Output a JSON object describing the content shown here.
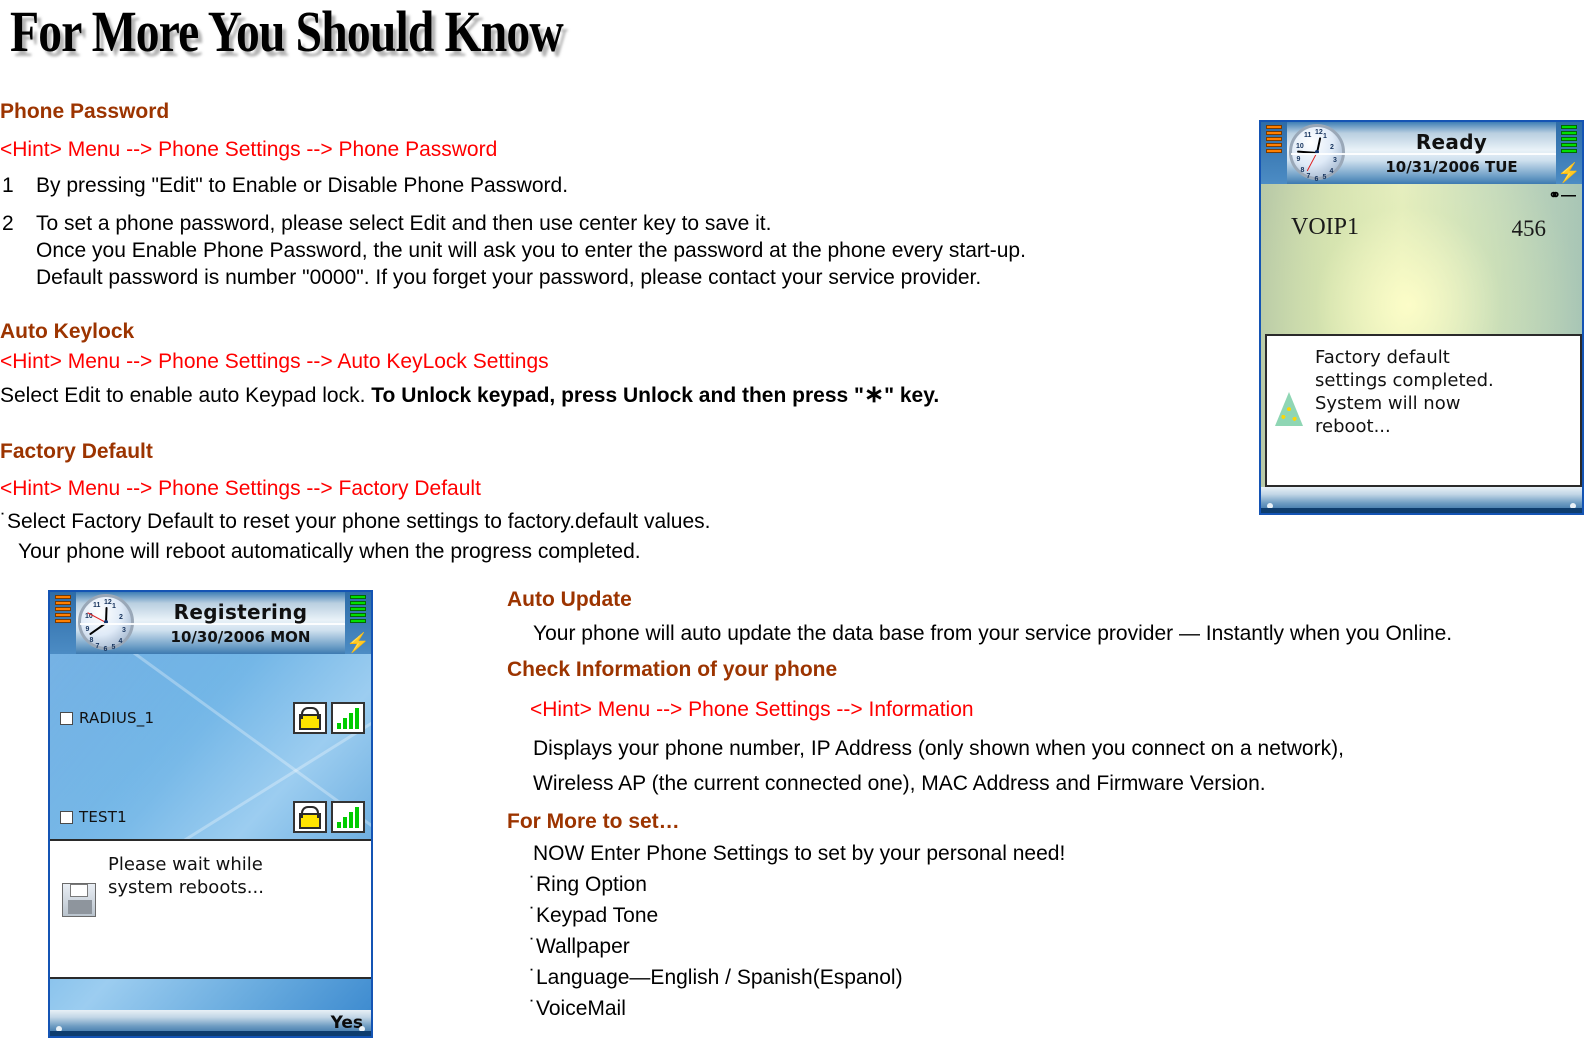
{
  "page": {
    "title": "For More You Should Know"
  },
  "sections": {
    "phone_password": {
      "heading": "Phone Password",
      "hint": "<Hint> Menu --> Phone Settings --> Phone Password",
      "items": [
        {
          "num": "1",
          "lines": [
            "By pressing \"Edit\" to Enable or Disable Phone Password."
          ]
        },
        {
          "num": "2",
          "lines": [
            "To set a phone password, please select Edit and then use center key to save it.",
            "Once you Enable Phone Password, the unit will ask you to enter the password at the phone every start-up.",
            "Default password is number \"0000\". If you forget your password, please contact your service provider."
          ]
        }
      ]
    },
    "auto_keylock": {
      "heading": "Auto Keylock",
      "hint": "<Hint> Menu --> Phone Settings --> Auto KeyLock Settings",
      "body_normal": "Select Edit to enable auto Keypad lock.",
      "body_bold_1": "To Unlock keypad, press Unlock and then press \"",
      "body_bold_star": "∗",
      "body_bold_2": "\" key."
    },
    "factory_default": {
      "heading": "Factory Default",
      "hint": "<Hint> Menu --> Phone Settings --> Factory Default",
      "bullet": "˙",
      "line1": "Select Factory Default to reset your phone settings to factory.default values.",
      "line2": "Your phone will reboot automatically when the progress completed."
    },
    "auto_update": {
      "heading": "Auto Update",
      "line1": "Your phone will auto update the data base from your service provider — Instantly when you Online."
    },
    "check_information": {
      "heading": "Check Information of your phone",
      "hint": "<Hint> Menu --> Phone Settings --> Information",
      "line1": "Displays your phone number, IP Address (only shown when you connect on a network),",
      "line2": "Wireless AP (the current connected one), MAC Address and Firmware Version."
    },
    "for_more_to_set": {
      "heading": "For More to set…",
      "intro": "NOW Enter Phone Settings to set by your personal need!",
      "bullet": "˙",
      "items": [
        "Ring Option",
        "Keypad Tone",
        "Wallpaper",
        "Language—English / Spanish(Espanol)",
        "VoiceMail"
      ]
    }
  },
  "phone_ready": {
    "status": "Ready",
    "date": "10/31/2006 TUE",
    "line_label": "VOIP1",
    "line_number": "456",
    "dialog_lines": [
      "Factory default",
      " settings completed.",
      "System will now",
      "reboot..."
    ]
  },
  "phone_registering": {
    "status": "Registering",
    "date": "10/30/2006 MON",
    "ap_list": [
      {
        "name": "RADIUS_1"
      },
      {
        "name": "TEST1"
      }
    ],
    "dialog_lines": [
      "Please wait while",
      " system reboots..."
    ],
    "softkey": "Yes"
  },
  "colors": {
    "heading": "#9C3400",
    "hint": "#FF0000",
    "body": "#000000",
    "phone_border": "#1454b4"
  }
}
